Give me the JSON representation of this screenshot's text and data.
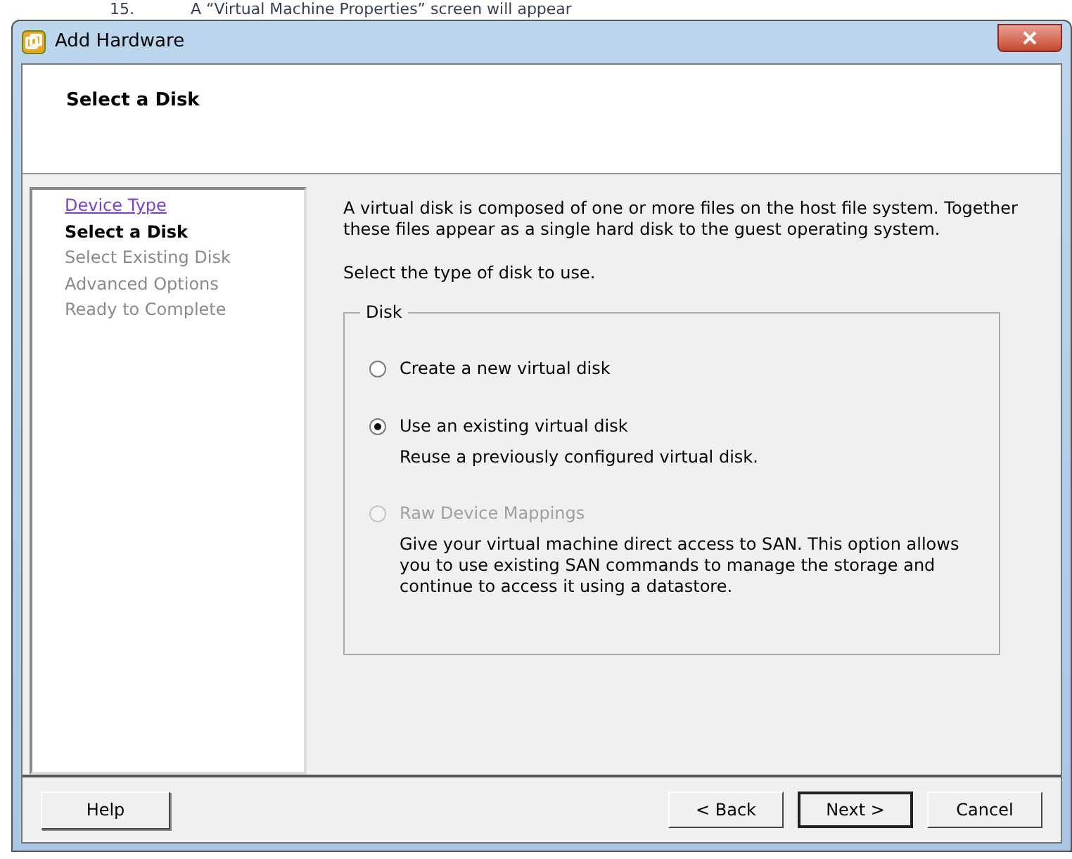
{
  "background_document": {
    "number": "15.",
    "text": "A “Virtual Machine Properties” screen will appear"
  },
  "window": {
    "title": "Add Hardware"
  },
  "header": {
    "title": "Select a Disk"
  },
  "steps": [
    {
      "label": "Device Type",
      "kind": "link"
    },
    {
      "label": "Select a Disk",
      "kind": "current"
    },
    {
      "label": "Select Existing Disk",
      "kind": "pending"
    },
    {
      "label": "Advanced Options",
      "kind": "pending"
    },
    {
      "label": "Ready to Complete",
      "kind": "pending"
    }
  ],
  "intro": "A virtual disk is composed of one or more files on the host file system. Together these files appear as a single hard disk to the guest operating system.",
  "prompt": "Select the type of disk to use.",
  "disk_group": {
    "legend": "Disk",
    "options": [
      {
        "label": "Create a new virtual disk",
        "selected": false,
        "disabled": false
      },
      {
        "label": "Use an existing virtual disk",
        "description": "Reuse a previously configured virtual disk.",
        "selected": true,
        "disabled": false
      },
      {
        "label": "Raw Device Mappings",
        "description": "Give your virtual machine direct access to SAN. This option allows you to use existing SAN commands to manage the storage and continue to access it using a datastore.",
        "selected": false,
        "disabled": true
      }
    ]
  },
  "buttons": {
    "help": "Help",
    "back": "< Back",
    "next": "Next >",
    "cancel": "Cancel"
  }
}
